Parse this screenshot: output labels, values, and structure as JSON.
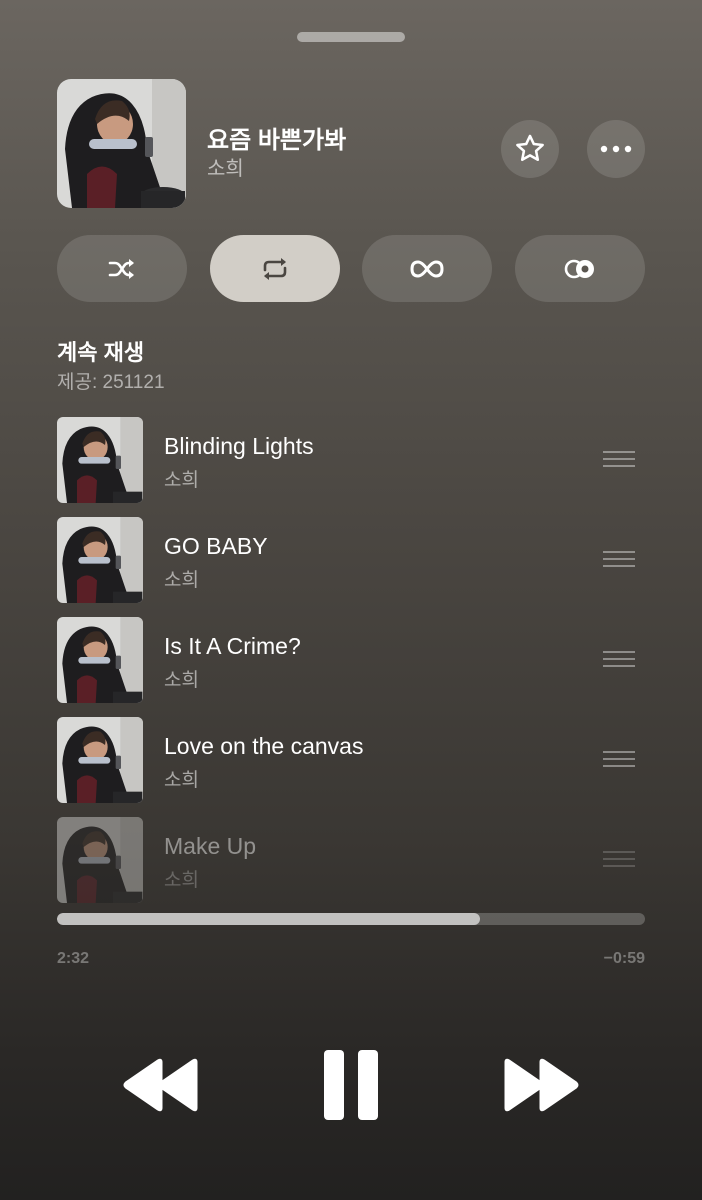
{
  "now_playing": {
    "title": "요즘 바쁜가봐",
    "artist": "소희",
    "star_icon": "star-outline-icon",
    "more_icon": "ellipsis-icon"
  },
  "modes": [
    {
      "name": "shuffle",
      "icon": "shuffle-icon",
      "active": false
    },
    {
      "name": "repeat",
      "icon": "repeat-icon",
      "active": true
    },
    {
      "name": "infinity",
      "icon": "infinity-icon",
      "active": false
    },
    {
      "name": "autoplay",
      "icon": "autoplay-circles-icon",
      "active": false
    }
  ],
  "section": {
    "title": "계속 재생",
    "subtitle": "제공: 251121"
  },
  "queue": [
    {
      "title": "Blinding Lights",
      "artist": "소희"
    },
    {
      "title": "GO BABY",
      "artist": "소희"
    },
    {
      "title": "Is It A Crime?",
      "artist": "소희"
    },
    {
      "title": "Love on the canvas",
      "artist": "소희"
    },
    {
      "title": "Make Up",
      "artist": "소희"
    }
  ],
  "playback": {
    "elapsed": "2:32",
    "remaining": "−0:59",
    "progress": 0.72
  },
  "colors": {
    "active_mode_bg": "#d2cec7",
    "active_mode_icon": "#4a4641"
  }
}
